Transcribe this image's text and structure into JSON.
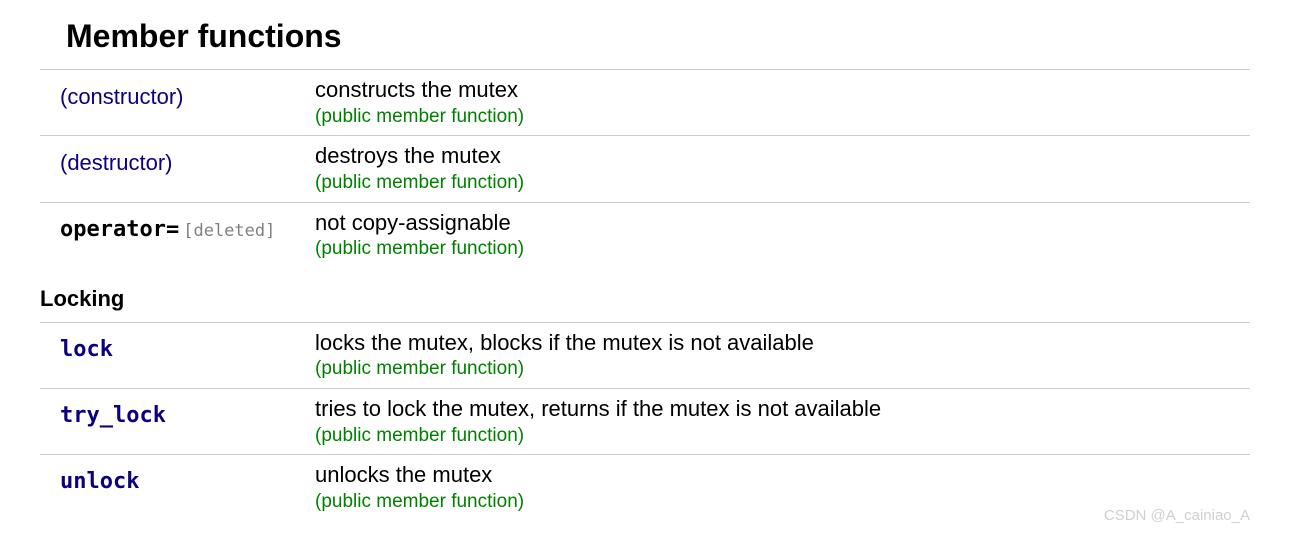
{
  "section_title": "Member functions",
  "rows_main": [
    {
      "name": "(constructor)",
      "mono": false,
      "deleted": "",
      "desc": "constructs the mutex",
      "attr": "(public member function)"
    },
    {
      "name": "(destructor)",
      "mono": false,
      "deleted": "",
      "desc": "destroys the mutex",
      "attr": "(public member function)"
    },
    {
      "name": "operator=",
      "mono": true,
      "nolink": true,
      "deleted": "[deleted]",
      "desc": "not copy-assignable",
      "attr": "(public member function)"
    }
  ],
  "subsection_title": "Locking",
  "rows_locking": [
    {
      "name": "lock",
      "mono": true,
      "deleted": "",
      "desc": "locks the mutex, blocks if the mutex is not available",
      "attr": "(public member function)"
    },
    {
      "name": "try_lock",
      "mono": true,
      "deleted": "",
      "desc": "tries to lock the mutex, returns if the mutex is not available",
      "attr": "(public member function)"
    },
    {
      "name": "unlock",
      "mono": true,
      "deleted": "",
      "desc": "unlocks the mutex",
      "attr": "(public member function)"
    }
  ],
  "watermark": "CSDN @A_cainiao_A"
}
